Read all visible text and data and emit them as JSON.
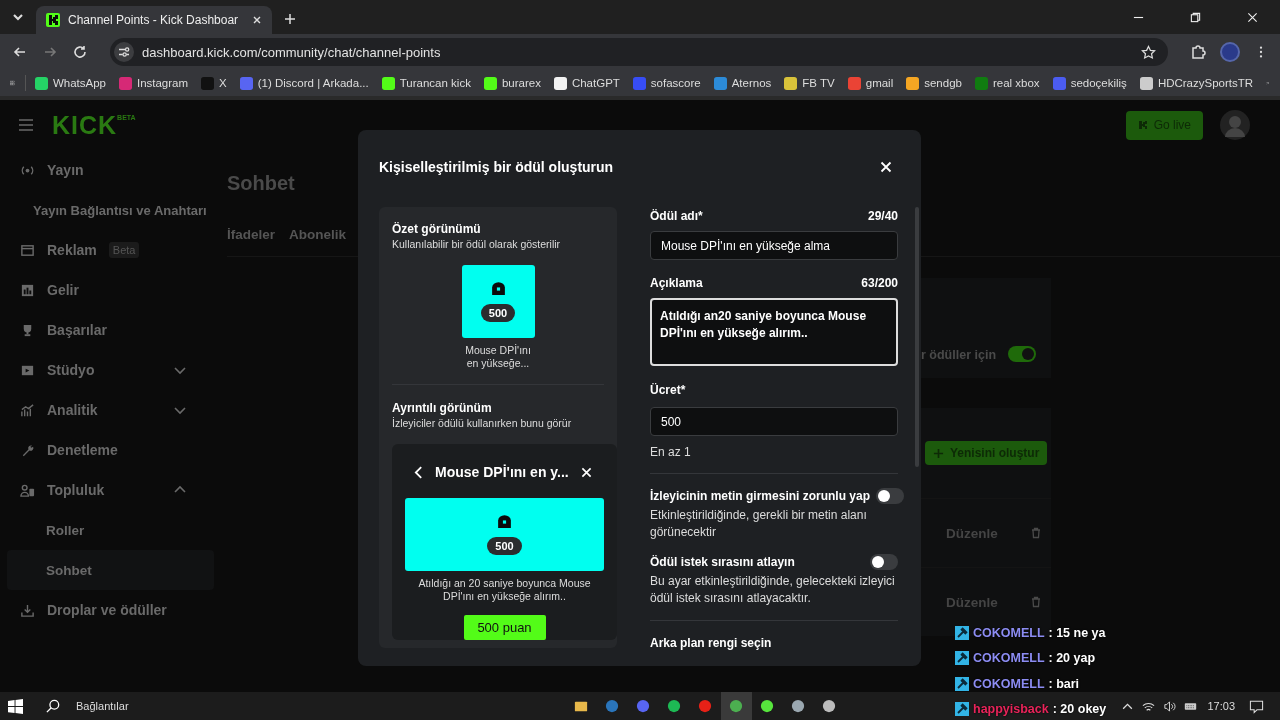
{
  "browser": {
    "tabs": [
      {
        "title": "Channel Points - Kick Dashboar",
        "selected": true
      }
    ],
    "url": "dashboard.kick.com/community/chat/channel-points",
    "bookmarks": [
      {
        "label": "WhatsApp"
      },
      {
        "label": "Instagram"
      },
      {
        "label": "X"
      },
      {
        "label": "(1) Discord | Arkada..."
      },
      {
        "label": "Turancan kick"
      },
      {
        "label": "burarex"
      },
      {
        "label": "ChatGPT"
      },
      {
        "label": "sofascore"
      },
      {
        "label": "Aternos"
      },
      {
        "label": "FB TV"
      },
      {
        "label": "gmail"
      },
      {
        "label": "sendgb"
      },
      {
        "label": "real xbox"
      },
      {
        "label": "sedoçekiliş"
      },
      {
        "label": "HDCrazySportsTR"
      }
    ]
  },
  "header": {
    "logo": "KICK",
    "logo_badge": "BETA",
    "go_live": "Go live"
  },
  "sidebar": {
    "items": [
      {
        "label": "Yayın",
        "selected": false,
        "children": [
          {
            "label": "Yayın Bağlantısı ve Anahtarı",
            "selected": false
          }
        ]
      },
      {
        "label": "Reklam",
        "badge": "Beta",
        "selected": false
      },
      {
        "label": "Gelir",
        "selected": false
      },
      {
        "label": "Başarılar",
        "selected": false
      },
      {
        "label": "Stüdyo",
        "expanded": false,
        "selected": false
      },
      {
        "label": "Analitik",
        "expanded": false,
        "selected": false
      },
      {
        "label": "Denetleme",
        "selected": false
      },
      {
        "label": "Topluluk",
        "expanded": true,
        "selected": false,
        "children": [
          {
            "label": "Roller",
            "selected": false
          },
          {
            "label": "Sohbet",
            "selected": true
          }
        ]
      },
      {
        "label": "Droplar ve ödüller",
        "selected": false
      }
    ]
  },
  "main": {
    "title": "Sohbet",
    "tabs": [
      {
        "label": "İfadeler"
      },
      {
        "label": "Abonelik"
      }
    ],
    "setting": {
      "label": "r ödüller için",
      "on": true
    },
    "create_button": "Yenisini oluştur",
    "rewards": [
      {
        "edit": "Düzenle"
      },
      {
        "edit": "Düzenle"
      }
    ]
  },
  "modal": {
    "title": "Kişiselleştirilmiş bir ödül oluşturun",
    "summary": {
      "heading": "Özet görünümü",
      "subtitle": "Kullanılabilir bir ödül olarak gösterilir",
      "cost": "500",
      "name": "Mouse DPİ'ını en yükseğe..."
    },
    "detail": {
      "heading": "Ayrıntılı görünüm",
      "subtitle": "İzleyiciler ödülü kullanırken bunu görür",
      "title": "Mouse DPİ'ını en y...",
      "cost": "500",
      "description": "Atıldığı an 20 saniye boyunca Mouse DPİ'ını en yükseğe alırım..",
      "button": "500 puan"
    },
    "fields": [
      {
        "kind": "input",
        "label": "Ödül adı*",
        "counter": "29/40",
        "value": "Mouse DPİ'ını en yükseğe alma"
      },
      {
        "kind": "textarea",
        "label": "Açıklama",
        "counter": "63/200",
        "value": "Atıldığı an20 saniye boyunca Mouse DPİ'ını en yükseğe alırım.."
      },
      {
        "kind": "input",
        "label": "Ücret*",
        "value": "500",
        "hint": "En az 1"
      }
    ],
    "toggles": [
      {
        "label": "İzleyicinin metin girmesini zorunlu yap",
        "description": "Etkinleştirildiğinde, gerekli bir metin alanı görünecektir",
        "on": false
      },
      {
        "label": "Ödül istek sırasını atlayın",
        "description": "Bu ayar etkinleştirildiğinde, gelecekteki izleyici ödül istek sırasını atlayacaktır.",
        "on": false
      }
    ],
    "next_section": "Arka plan rengi seçin"
  },
  "chat": [
    {
      "user": "COKOMELL",
      "text": ": 15 ne ya",
      "color": "#8c8cf2"
    },
    {
      "user": "COKOMELL",
      "text": ": 20 yap",
      "color": "#8c8cf2"
    },
    {
      "user": "COKOMELL",
      "text": ": bari",
      "color": "#8c8cf2"
    },
    {
      "user": "happyisback",
      "text": ": 20 okey",
      "color": "#e8245a"
    }
  ],
  "taskbar": {
    "search": "Bağlantılar",
    "clock": "17:03"
  }
}
